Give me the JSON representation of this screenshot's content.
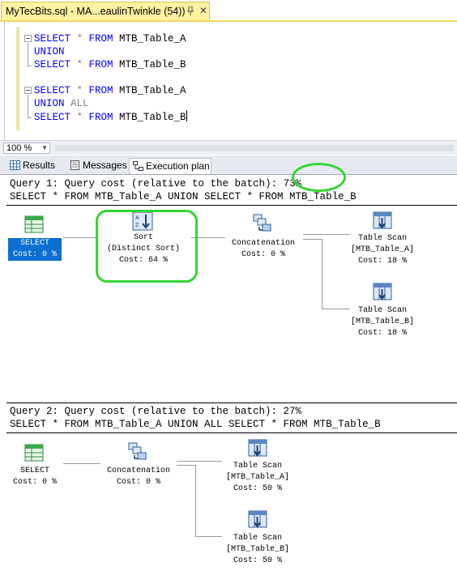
{
  "document_tab": {
    "title": "MyTecBits.sql - MA...eaulinTwinkle (54))",
    "close_glyph": "✕"
  },
  "editor": {
    "lines": [
      {
        "kw1": "SELECT",
        "op": " * ",
        "kw2": "FROM",
        "ident": " MTB_Table_A"
      },
      {
        "kw1": "UNION"
      },
      {
        "kw1": "SELECT",
        "op": " * ",
        "kw2": "FROM",
        "ident": " MTB_Table_B"
      },
      {
        "kw1": "SELECT",
        "op": " * ",
        "kw2": "FROM",
        "ident": " MTB_Table_A"
      },
      {
        "kw1": "UNION",
        "op": " ALL"
      },
      {
        "kw1": "SELECT",
        "op": " * ",
        "kw2": "FROM",
        "ident": " MTB_Table_B"
      }
    ]
  },
  "zoom": {
    "value": "100 %"
  },
  "result_tabs": [
    {
      "label": "Results",
      "icon": "grid-icon"
    },
    {
      "label": "Messages",
      "icon": "messages-icon"
    },
    {
      "label": "Execution plan",
      "icon": "execution-plan-icon",
      "active": true
    }
  ],
  "query1": {
    "header_prefix": "Query 1: Query cost (relative to the batch",
    "header_close": "): ",
    "cost": "73%",
    "sql": "SELECT * FROM MTB_Table_A UNION SELECT * FROM MTB_Table_B",
    "nodes": {
      "select": {
        "name": "SELECT",
        "cost": "Cost: 0 %"
      },
      "sort": {
        "name": "Sort",
        "sub": "(Distinct Sort)",
        "cost": "Cost: 64 %"
      },
      "concat": {
        "name": "Concatenation",
        "cost": "Cost: 0 %"
      },
      "scan_a": {
        "name": "Table Scan",
        "table": "[MTB_Table_A]",
        "cost": "Cost: 18 %"
      },
      "scan_b": {
        "name": "Table Scan",
        "table": "[MTB_Table_B]",
        "cost": "Cost: 18 %"
      }
    }
  },
  "query2": {
    "header": "Query 2: Query cost (relative to the batch): 27%",
    "sql": "SELECT * FROM MTB_Table_A UNION ALL SELECT * FROM MTB_Table_B",
    "nodes": {
      "select": {
        "name": "SELECT",
        "cost": "Cost: 0 %"
      },
      "concat": {
        "name": "Concatenation",
        "cost": "Cost: 0 %"
      },
      "scan_a": {
        "name": "Table Scan",
        "table": "[MTB_Table_A]",
        "cost": "Cost: 50 %"
      },
      "scan_b": {
        "name": "Table Scan",
        "table": "[MTB_Table_B]",
        "cost": "Cost: 50 %"
      }
    }
  },
  "colors": {
    "tab_active": "#fff2a0",
    "keyword": "#0000ff",
    "operator": "#808080",
    "highlight": "#33d633",
    "selected_node": "#0a6fd0"
  }
}
